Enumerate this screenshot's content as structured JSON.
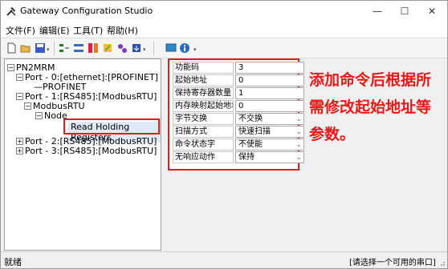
{
  "window": {
    "title": "Gateway Configuration Studio",
    "minimize": "—",
    "maximize": "☐",
    "close": "✕"
  },
  "menu": [
    "文件(F)",
    "编辑(E)",
    "工具(T)",
    "帮助(H)"
  ],
  "toolbar": {
    "icons": [
      "new-icon",
      "open-icon",
      "save-icon",
      "add-port-icon",
      "add-module-icon",
      "add-command-icon",
      "edit-icon",
      "settings-icon",
      "download-icon",
      "monitor-icon",
      "info-icon"
    ]
  },
  "tree": {
    "root": "PN2MRM",
    "port0": "Port - 0:[ethernet]:[PROFINET]",
    "profinet": "PROFINET",
    "port1": "Port - 1:[RS485]:[ModbusRTU]",
    "modbus": "ModbusRTU",
    "node": "Node",
    "command": "Read Holding Registers",
    "port2": "Port - 2:[RS485]:[ModbusRTU]",
    "port3": "Port - 3:[RS485]:[ModbusRTU]"
  },
  "properties": [
    {
      "label": "功能码",
      "value": "3",
      "type": "text"
    },
    {
      "label": "起始地址",
      "value": "0",
      "type": "text"
    },
    {
      "label": "保持寄存器数量",
      "value": "1",
      "type": "text"
    },
    {
      "label": "内存映射起始地址",
      "value": "0",
      "type": "text"
    },
    {
      "label": "字节交换",
      "value": "不交换",
      "type": "combo"
    },
    {
      "label": "扫描方式",
      "value": "快速扫描",
      "type": "combo"
    },
    {
      "label": "命令状态字",
      "value": "不使能",
      "type": "combo"
    },
    {
      "label": "无响应动作",
      "value": "保持",
      "type": "combo"
    }
  ],
  "annotation": "添加命令后根据所需修改起始地址等参数。",
  "status": {
    "left": "就绪",
    "right": "[请选择一个可用的串口]"
  },
  "colors": {
    "highlight": "#e31b1b",
    "selection": "#dfe9f7"
  }
}
